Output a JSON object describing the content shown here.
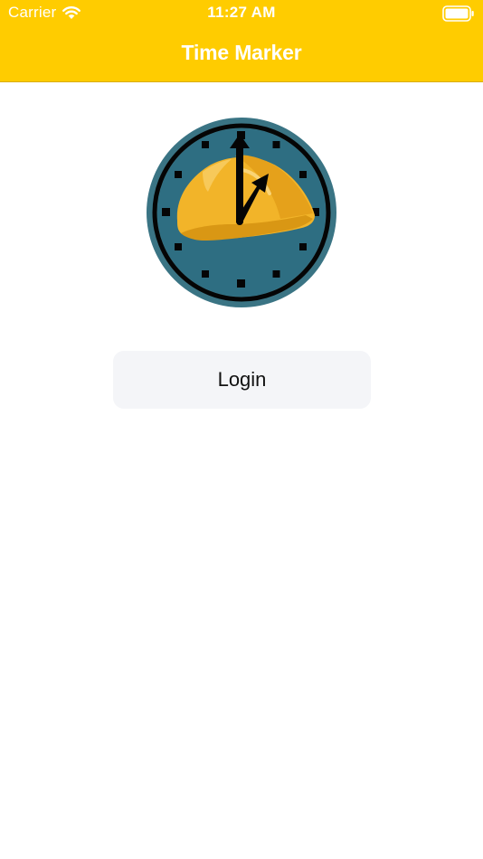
{
  "status_bar": {
    "carrier": "Carrier",
    "time": "11:27 AM",
    "wifi_icon": "wifi-icon",
    "battery_icon": "battery-icon"
  },
  "nav": {
    "title": "Time Marker"
  },
  "logo": {
    "icon": "hardhat-clock-logo",
    "colors": {
      "dial": "#2e6e82",
      "helmet": "#f2b429",
      "hands": "#000000"
    }
  },
  "actions": {
    "login_label": "Login"
  },
  "colors": {
    "accent": "#ffcc00",
    "button_bg": "#f4f5f8",
    "background": "#ffffff"
  }
}
